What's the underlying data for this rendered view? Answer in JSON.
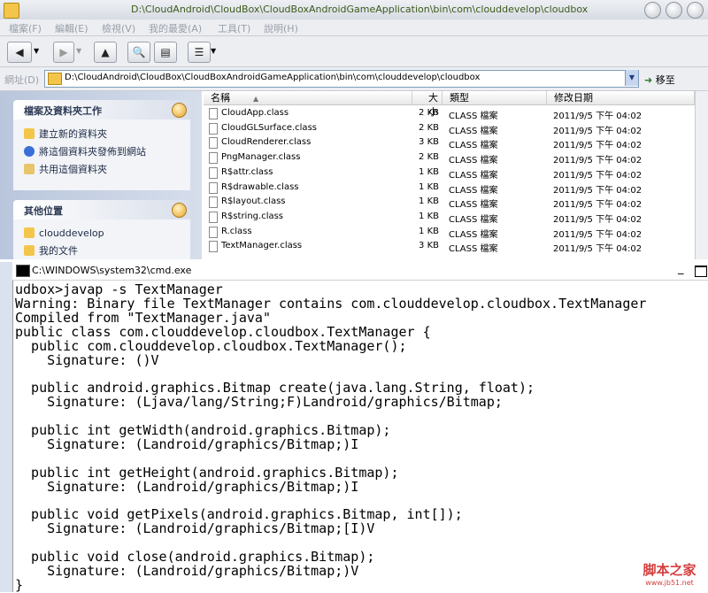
{
  "explorer": {
    "title": "D:\\CloudAndroid\\CloudBox\\CloudBoxAndroidGameApplication\\bin\\com\\clouddevelop\\cloudbox",
    "menu": [
      "檔案(F)",
      "編輯(E)",
      "檢視(V)",
      "我的最愛(A)",
      "工具(T)",
      "說明(H)"
    ],
    "address_label": "網址(D)",
    "address_value": "D:\\CloudAndroid\\CloudBox\\CloudBoxAndroidGameApplication\\bin\\com\\clouddevelop\\cloudbox",
    "go_label": "移至",
    "task_pane": {
      "file_tasks_title": "檔案及資料夾工作",
      "file_tasks": [
        "建立新的資料夾",
        "將這個資料夾發佈到網站",
        "共用這個資料夾"
      ],
      "other_places_title": "其他位置",
      "other_places": [
        "clouddevelop",
        "我的文件"
      ]
    },
    "columns": [
      "名稱",
      "大小",
      "類型",
      "修改日期"
    ],
    "files": [
      {
        "name": "CloudApp.class",
        "size": "2 KB",
        "type": "CLASS 檔案",
        "date": "2011/9/5 下午 04:02"
      },
      {
        "name": "CloudGLSurface.class",
        "size": "2 KB",
        "type": "CLASS 檔案",
        "date": "2011/9/5 下午 04:02"
      },
      {
        "name": "CloudRenderer.class",
        "size": "3 KB",
        "type": "CLASS 檔案",
        "date": "2011/9/5 下午 04:02"
      },
      {
        "name": "PngManager.class",
        "size": "2 KB",
        "type": "CLASS 檔案",
        "date": "2011/9/5 下午 04:02"
      },
      {
        "name": "R$attr.class",
        "size": "1 KB",
        "type": "CLASS 檔案",
        "date": "2011/9/5 下午 04:02"
      },
      {
        "name": "R$drawable.class",
        "size": "1 KB",
        "type": "CLASS 檔案",
        "date": "2011/9/5 下午 04:02"
      },
      {
        "name": "R$layout.class",
        "size": "1 KB",
        "type": "CLASS 檔案",
        "date": "2011/9/5 下午 04:02"
      },
      {
        "name": "R$string.class",
        "size": "1 KB",
        "type": "CLASS 檔案",
        "date": "2011/9/5 下午 04:02"
      },
      {
        "name": "R.class",
        "size": "1 KB",
        "type": "CLASS 檔案",
        "date": "2011/9/5 下午 04:02"
      },
      {
        "name": "TextManager.class",
        "size": "3 KB",
        "type": "CLASS 檔案",
        "date": "2011/9/5 下午 04:02"
      }
    ]
  },
  "cmd": {
    "title": "C:\\WINDOWS\\system32\\cmd.exe",
    "min_label": "_",
    "lines": [
      "udbox>javap -s TextManager",
      "Warning: Binary file TextManager contains com.clouddevelop.cloudbox.TextManager",
      "Compiled from \"TextManager.java\"",
      "public class com.clouddevelop.cloudbox.TextManager {",
      "  public com.clouddevelop.cloudbox.TextManager();",
      "    Signature: ()V",
      "",
      "  public android.graphics.Bitmap create(java.lang.String, float);",
      "    Signature: (Ljava/lang/String;F)Landroid/graphics/Bitmap;",
      "",
      "  public int getWidth(android.graphics.Bitmap);",
      "    Signature: (Landroid/graphics/Bitmap;)I",
      "",
      "  public int getHeight(android.graphics.Bitmap);",
      "    Signature: (Landroid/graphics/Bitmap;)I",
      "",
      "  public void getPixels(android.graphics.Bitmap, int[]);",
      "    Signature: (Landroid/graphics/Bitmap;[I)V",
      "",
      "  public void close(android.graphics.Bitmap);",
      "    Signature: (Landroid/graphics/Bitmap;)V",
      "}"
    ]
  },
  "watermark": {
    "line1": "脚本之家",
    "line2": "www.jb51.net"
  }
}
